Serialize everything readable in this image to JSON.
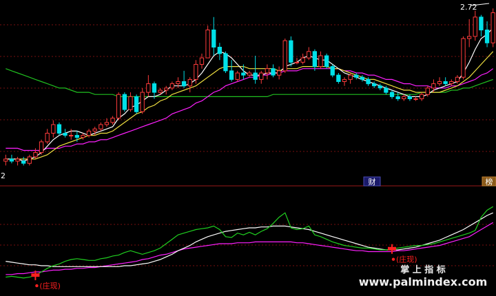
{
  "chart_data": [
    {
      "type": "candlestick",
      "ylim": [
        1.95,
        2.75
      ],
      "price_labels": {
        "high": "2.72",
        "low": "2"
      },
      "colors": {
        "up": "#ff3b3b",
        "down": "#00e0e8",
        "ma_fast": "#ffffff",
        "ma_mid": "#f0e040",
        "ma_slow": "#ff20ff",
        "ma_long": "#20c020",
        "grid": "#7a1010"
      },
      "candles": [
        {
          "o": 2.02,
          "h": 2.05,
          "l": 2.0,
          "c": 2.03
        },
        {
          "o": 2.03,
          "h": 2.05,
          "l": 2.01,
          "c": 2.02
        },
        {
          "o": 2.02,
          "h": 2.04,
          "l": 2.0,
          "c": 2.03
        },
        {
          "o": 2.02,
          "h": 2.04,
          "l": 2.0,
          "c": 2.01
        },
        {
          "o": 2.01,
          "h": 2.05,
          "l": 2.0,
          "c": 2.04
        },
        {
          "o": 2.04,
          "h": 2.08,
          "l": 2.03,
          "c": 2.06
        },
        {
          "o": 2.06,
          "h": 2.12,
          "l": 2.05,
          "c": 2.11
        },
        {
          "o": 2.11,
          "h": 2.17,
          "l": 2.1,
          "c": 2.15
        },
        {
          "o": 2.15,
          "h": 2.21,
          "l": 2.13,
          "c": 2.19
        },
        {
          "o": 2.19,
          "h": 2.2,
          "l": 2.14,
          "c": 2.15
        },
        {
          "o": 2.15,
          "h": 2.17,
          "l": 2.13,
          "c": 2.14
        },
        {
          "o": 2.14,
          "h": 2.17,
          "l": 2.12,
          "c": 2.14
        },
        {
          "o": 2.14,
          "h": 2.16,
          "l": 2.11,
          "c": 2.13
        },
        {
          "o": 2.13,
          "h": 2.15,
          "l": 2.12,
          "c": 2.14
        },
        {
          "o": 2.14,
          "h": 2.17,
          "l": 2.13,
          "c": 2.16
        },
        {
          "o": 2.16,
          "h": 2.18,
          "l": 2.14,
          "c": 2.17
        },
        {
          "o": 2.17,
          "h": 2.2,
          "l": 2.16,
          "c": 2.19
        },
        {
          "o": 2.19,
          "h": 2.22,
          "l": 2.18,
          "c": 2.2
        },
        {
          "o": 2.2,
          "h": 2.23,
          "l": 2.19,
          "c": 2.22
        },
        {
          "o": 2.22,
          "h": 2.34,
          "l": 2.21,
          "c": 2.33
        },
        {
          "o": 2.33,
          "h": 2.34,
          "l": 2.25,
          "c": 2.26
        },
        {
          "o": 2.26,
          "h": 2.34,
          "l": 2.25,
          "c": 2.32
        },
        {
          "o": 2.32,
          "h": 2.33,
          "l": 2.24,
          "c": 2.25
        },
        {
          "o": 2.25,
          "h": 2.36,
          "l": 2.24,
          "c": 2.34
        },
        {
          "o": 2.34,
          "h": 2.42,
          "l": 2.32,
          "c": 2.38
        },
        {
          "o": 2.38,
          "h": 2.39,
          "l": 2.31,
          "c": 2.34
        },
        {
          "o": 2.34,
          "h": 2.36,
          "l": 2.33,
          "c": 2.35
        },
        {
          "o": 2.35,
          "h": 2.37,
          "l": 2.33,
          "c": 2.36
        },
        {
          "o": 2.36,
          "h": 2.39,
          "l": 2.35,
          "c": 2.38
        },
        {
          "o": 2.38,
          "h": 2.41,
          "l": 2.36,
          "c": 2.39
        },
        {
          "o": 2.39,
          "h": 2.44,
          "l": 2.36,
          "c": 2.37
        },
        {
          "o": 2.37,
          "h": 2.41,
          "l": 2.34,
          "c": 2.4
        },
        {
          "o": 2.4,
          "h": 2.49,
          "l": 2.38,
          "c": 2.47
        },
        {
          "o": 2.47,
          "h": 2.52,
          "l": 2.45,
          "c": 2.5
        },
        {
          "o": 2.5,
          "h": 2.65,
          "l": 2.5,
          "c": 2.63
        },
        {
          "o": 2.63,
          "h": 2.69,
          "l": 2.51,
          "c": 2.55
        },
        {
          "o": 2.55,
          "h": 2.57,
          "l": 2.49,
          "c": 2.52
        },
        {
          "o": 2.52,
          "h": 2.53,
          "l": 2.43,
          "c": 2.44
        },
        {
          "o": 2.44,
          "h": 2.49,
          "l": 2.39,
          "c": 2.4
        },
        {
          "o": 2.4,
          "h": 2.44,
          "l": 2.39,
          "c": 2.43
        },
        {
          "o": 2.43,
          "h": 2.47,
          "l": 2.4,
          "c": 2.42
        },
        {
          "o": 2.42,
          "h": 2.44,
          "l": 2.41,
          "c": 2.43
        },
        {
          "o": 2.43,
          "h": 2.51,
          "l": 2.38,
          "c": 2.4
        },
        {
          "o": 2.4,
          "h": 2.44,
          "l": 2.38,
          "c": 2.43
        },
        {
          "o": 2.43,
          "h": 2.47,
          "l": 2.4,
          "c": 2.45
        },
        {
          "o": 2.45,
          "h": 2.47,
          "l": 2.41,
          "c": 2.42
        },
        {
          "o": 2.42,
          "h": 2.46,
          "l": 2.4,
          "c": 2.44
        },
        {
          "o": 2.44,
          "h": 2.59,
          "l": 2.43,
          "c": 2.58
        },
        {
          "o": 2.58,
          "h": 2.6,
          "l": 2.46,
          "c": 2.48
        },
        {
          "o": 2.48,
          "h": 2.5,
          "l": 2.47,
          "c": 2.48
        },
        {
          "o": 2.48,
          "h": 2.52,
          "l": 2.47,
          "c": 2.5
        },
        {
          "o": 2.5,
          "h": 2.55,
          "l": 2.49,
          "c": 2.53
        },
        {
          "o": 2.53,
          "h": 2.54,
          "l": 2.44,
          "c": 2.46
        },
        {
          "o": 2.46,
          "h": 2.53,
          "l": 2.45,
          "c": 2.51
        },
        {
          "o": 2.51,
          "h": 2.52,
          "l": 2.45,
          "c": 2.46
        },
        {
          "o": 2.46,
          "h": 2.47,
          "l": 2.41,
          "c": 2.42
        },
        {
          "o": 2.42,
          "h": 2.43,
          "l": 2.38,
          "c": 2.39
        },
        {
          "o": 2.39,
          "h": 2.41,
          "l": 2.37,
          "c": 2.4
        },
        {
          "o": 2.4,
          "h": 2.43,
          "l": 2.38,
          "c": 2.42
        },
        {
          "o": 2.42,
          "h": 2.43,
          "l": 2.4,
          "c": 2.41
        },
        {
          "o": 2.41,
          "h": 2.42,
          "l": 2.39,
          "c": 2.4
        },
        {
          "o": 2.4,
          "h": 2.41,
          "l": 2.37,
          "c": 2.38
        },
        {
          "o": 2.38,
          "h": 2.39,
          "l": 2.36,
          "c": 2.37
        },
        {
          "o": 2.37,
          "h": 2.38,
          "l": 2.35,
          "c": 2.36
        },
        {
          "o": 2.36,
          "h": 2.37,
          "l": 2.33,
          "c": 2.34
        },
        {
          "o": 2.34,
          "h": 2.35,
          "l": 2.31,
          "c": 2.32
        },
        {
          "o": 2.32,
          "h": 2.34,
          "l": 2.3,
          "c": 2.31
        },
        {
          "o": 2.31,
          "h": 2.33,
          "l": 2.3,
          "c": 2.32
        },
        {
          "o": 2.32,
          "h": 2.33,
          "l": 2.3,
          "c": 2.31
        },
        {
          "o": 2.31,
          "h": 2.32,
          "l": 2.3,
          "c": 2.31
        },
        {
          "o": 2.31,
          "h": 2.34,
          "l": 2.3,
          "c": 2.33
        },
        {
          "o": 2.33,
          "h": 2.37,
          "l": 2.32,
          "c": 2.36
        },
        {
          "o": 2.36,
          "h": 2.4,
          "l": 2.34,
          "c": 2.38
        },
        {
          "o": 2.38,
          "h": 2.41,
          "l": 2.37,
          "c": 2.39
        },
        {
          "o": 2.39,
          "h": 2.41,
          "l": 2.37,
          "c": 2.38
        },
        {
          "o": 2.38,
          "h": 2.4,
          "l": 2.37,
          "c": 2.39
        },
        {
          "o": 2.39,
          "h": 2.42,
          "l": 2.38,
          "c": 2.41
        },
        {
          "o": 2.41,
          "h": 2.6,
          "l": 2.4,
          "c": 2.59
        },
        {
          "o": 2.59,
          "h": 2.68,
          "l": 2.55,
          "c": 2.6
        },
        {
          "o": 2.6,
          "h": 2.72,
          "l": 2.58,
          "c": 2.69
        },
        {
          "o": 2.69,
          "h": 2.7,
          "l": 2.6,
          "c": 2.63
        },
        {
          "o": 2.63,
          "h": 2.67,
          "l": 2.55,
          "c": 2.57
        },
        {
          "o": 2.57,
          "h": 2.73,
          "l": 2.55,
          "c": 2.71
        }
      ],
      "ma_fast": [
        2.03,
        2.03,
        2.03,
        2.02,
        2.03,
        2.04,
        2.06,
        2.09,
        2.12,
        2.14,
        2.15,
        2.16,
        2.16,
        2.15,
        2.14,
        2.15,
        2.16,
        2.17,
        2.18,
        2.22,
        2.24,
        2.27,
        2.28,
        2.3,
        2.32,
        2.32,
        2.33,
        2.35,
        2.37,
        2.37,
        2.37,
        2.38,
        2.4,
        2.43,
        2.47,
        2.51,
        2.53,
        2.52,
        2.5,
        2.47,
        2.44,
        2.42,
        2.42,
        2.42,
        2.43,
        2.43,
        2.43,
        2.46,
        2.47,
        2.48,
        2.5,
        2.51,
        2.5,
        2.49,
        2.49,
        2.47,
        2.45,
        2.43,
        2.42,
        2.41,
        2.4,
        2.39,
        2.38,
        2.37,
        2.36,
        2.35,
        2.34,
        2.33,
        2.32,
        2.32,
        2.32,
        2.33,
        2.35,
        2.36,
        2.37,
        2.38,
        2.39,
        2.43,
        2.48,
        2.54,
        2.59,
        2.61,
        2.64
      ],
      "ma_mid": [
        2.03,
        2.03,
        2.03,
        2.03,
        2.03,
        2.03,
        2.04,
        2.05,
        2.07,
        2.09,
        2.1,
        2.11,
        2.12,
        2.13,
        2.14,
        2.14,
        2.15,
        2.15,
        2.16,
        2.18,
        2.2,
        2.22,
        2.24,
        2.25,
        2.27,
        2.28,
        2.3,
        2.31,
        2.33,
        2.34,
        2.35,
        2.36,
        2.37,
        2.39,
        2.41,
        2.43,
        2.45,
        2.46,
        2.46,
        2.46,
        2.46,
        2.45,
        2.45,
        2.45,
        2.45,
        2.45,
        2.44,
        2.45,
        2.45,
        2.45,
        2.46,
        2.46,
        2.46,
        2.46,
        2.46,
        2.45,
        2.45,
        2.44,
        2.43,
        2.42,
        2.41,
        2.4,
        2.4,
        2.39,
        2.38,
        2.37,
        2.36,
        2.35,
        2.35,
        2.34,
        2.34,
        2.34,
        2.34,
        2.34,
        2.35,
        2.36,
        2.37,
        2.39,
        2.41,
        2.44,
        2.47,
        2.5,
        2.53
      ],
      "ma_slow": [
        2.08,
        2.08,
        2.08,
        2.07,
        2.07,
        2.07,
        2.07,
        2.08,
        2.08,
        2.08,
        2.09,
        2.09,
        2.1,
        2.1,
        2.11,
        2.11,
        2.12,
        2.12,
        2.13,
        2.14,
        2.15,
        2.16,
        2.17,
        2.18,
        2.19,
        2.2,
        2.21,
        2.22,
        2.24,
        2.25,
        2.26,
        2.27,
        2.29,
        2.3,
        2.32,
        2.34,
        2.35,
        2.37,
        2.38,
        2.39,
        2.4,
        2.41,
        2.41,
        2.42,
        2.42,
        2.43,
        2.43,
        2.44,
        2.44,
        2.44,
        2.45,
        2.45,
        2.45,
        2.45,
        2.45,
        2.45,
        2.45,
        2.44,
        2.44,
        2.43,
        2.43,
        2.42,
        2.42,
        2.41,
        2.4,
        2.4,
        2.39,
        2.38,
        2.38,
        2.37,
        2.37,
        2.37,
        2.36,
        2.36,
        2.36,
        2.37,
        2.37,
        2.38,
        2.39,
        2.4,
        2.42,
        2.43,
        2.45
      ],
      "ma_long": [
        2.45,
        2.44,
        2.43,
        2.42,
        2.41,
        2.4,
        2.39,
        2.38,
        2.37,
        2.36,
        2.36,
        2.35,
        2.34,
        2.34,
        2.34,
        2.33,
        2.33,
        2.33,
        2.33,
        2.32,
        2.32,
        2.32,
        2.32,
        2.32,
        2.32,
        2.32,
        2.32,
        2.32,
        2.32,
        2.32,
        2.32,
        2.32,
        2.32,
        2.32,
        2.32,
        2.32,
        2.32,
        2.32,
        2.32,
        2.32,
        2.32,
        2.32,
        2.32,
        2.32,
        2.32,
        2.33,
        2.33,
        2.33,
        2.33,
        2.33,
        2.33,
        2.33,
        2.33,
        2.33,
        2.33,
        2.33,
        2.33,
        2.33,
        2.33,
        2.33,
        2.33,
        2.33,
        2.33,
        2.33,
        2.33,
        2.33,
        2.33,
        2.33,
        2.33,
        2.33,
        2.34,
        2.34,
        2.34,
        2.34,
        2.34,
        2.35,
        2.35,
        2.36,
        2.36,
        2.37,
        2.38,
        2.39,
        2.4
      ]
    },
    {
      "type": "line",
      "ylim": [
        0,
        100
      ],
      "series_colors": {
        "white": "#ffffff",
        "green": "#20d020",
        "magenta": "#ff20ff"
      },
      "white": [
        30,
        29,
        28,
        27,
        26,
        26,
        25,
        25,
        24,
        24,
        24,
        24,
        24,
        24,
        24,
        24,
        24,
        24,
        24,
        24,
        25,
        25,
        26,
        27,
        28,
        30,
        32,
        35,
        38,
        42,
        45,
        48,
        52,
        55,
        58,
        60,
        62,
        64,
        65,
        66,
        67,
        68,
        68,
        69,
        69,
        70,
        70,
        70,
        69,
        68,
        67,
        66,
        64,
        62,
        60,
        58,
        56,
        54,
        52,
        50,
        48,
        46,
        45,
        44,
        43,
        43,
        43,
        44,
        45,
        46,
        48,
        50,
        52,
        54,
        57,
        60,
        63,
        66,
        70,
        74,
        78,
        82,
        85
      ],
      "green": [
        12,
        13,
        12,
        11,
        12,
        14,
        18,
        22,
        25,
        27,
        30,
        32,
        33,
        32,
        31,
        31,
        33,
        34,
        36,
        37,
        40,
        42,
        40,
        38,
        40,
        42,
        45,
        50,
        55,
        60,
        62,
        64,
        66,
        67,
        68,
        70,
        66,
        58,
        57,
        62,
        60,
        63,
        60,
        64,
        67,
        73,
        80,
        85,
        68,
        66,
        67,
        70,
        60,
        58,
        55,
        52,
        50,
        48,
        47,
        46,
        45,
        45,
        44,
        43,
        43,
        44,
        45,
        46,
        47,
        48,
        48,
        49,
        50,
        52,
        54,
        56,
        58,
        60,
        62,
        65,
        80,
        88,
        92
      ],
      "magenta": [
        15,
        15,
        16,
        16,
        17,
        18,
        18,
        19,
        20,
        20,
        21,
        21,
        22,
        22,
        23,
        23,
        24,
        25,
        26,
        27,
        28,
        29,
        30,
        32,
        33,
        35,
        37,
        38,
        40,
        42,
        44,
        45,
        46,
        47,
        48,
        49,
        50,
        50,
        50,
        51,
        51,
        51,
        52,
        52,
        52,
        52,
        52,
        52,
        52,
        51,
        51,
        50,
        49,
        48,
        47,
        46,
        45,
        44,
        43,
        42,
        42,
        41,
        41,
        41,
        41,
        41,
        42,
        42,
        43,
        44,
        45,
        46,
        47,
        48,
        50,
        52,
        54,
        56,
        58,
        62,
        66,
        70,
        74
      ],
      "signals": [
        {
          "index": 5,
          "label": "(庄现)",
          "color": "#ff2020"
        },
        {
          "index": 65,
          "label": "(庄现)",
          "color": "#ff2020"
        }
      ]
    }
  ],
  "badges": {
    "cai": "财",
    "bang": "榜"
  },
  "watermark": {
    "line1": "掌 上 指 标",
    "line2": "www.palmindex.com"
  }
}
